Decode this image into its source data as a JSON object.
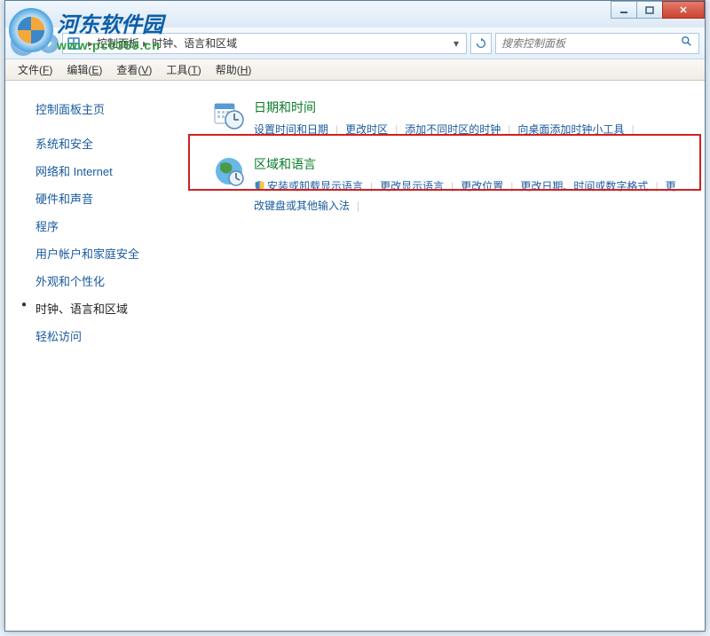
{
  "watermark": {
    "title": "河东软件园",
    "url": "www.pc0359.cn"
  },
  "titlebar": {},
  "breadcrumb": {
    "parts": [
      "控制面板",
      "时钟、语言和区域"
    ]
  },
  "search": {
    "placeholder": "搜索控制面板"
  },
  "menus": [
    {
      "label": "文件",
      "key": "F"
    },
    {
      "label": "编辑",
      "key": "E"
    },
    {
      "label": "查看",
      "key": "V"
    },
    {
      "label": "工具",
      "key": "T"
    },
    {
      "label": "帮助",
      "key": "H"
    }
  ],
  "sidebar": {
    "home": "控制面板主页",
    "items": [
      {
        "label": "系统和安全",
        "active": false
      },
      {
        "label": "网络和 Internet",
        "active": false
      },
      {
        "label": "硬件和声音",
        "active": false
      },
      {
        "label": "程序",
        "active": false
      },
      {
        "label": "用户帐户和家庭安全",
        "active": false
      },
      {
        "label": "外观和个性化",
        "active": false
      },
      {
        "label": "时钟、语言和区域",
        "active": true
      },
      {
        "label": "轻松访问",
        "active": false
      }
    ]
  },
  "categories": [
    {
      "title": "日期和时间",
      "links": [
        {
          "text": "设置时间和日期"
        },
        {
          "text": "更改时区"
        },
        {
          "text": "添加不同时区的时钟"
        },
        {
          "text": "向桌面添加时钟小工具"
        }
      ]
    },
    {
      "title": "区域和语言",
      "links": [
        {
          "text": "安装或卸载显示语言",
          "shield": true
        },
        {
          "text": "更改显示语言"
        },
        {
          "text": "更改位置"
        },
        {
          "text": "更改日期、时间或数字格式"
        },
        {
          "text": "更改键盘或其他输入法"
        }
      ]
    }
  ]
}
